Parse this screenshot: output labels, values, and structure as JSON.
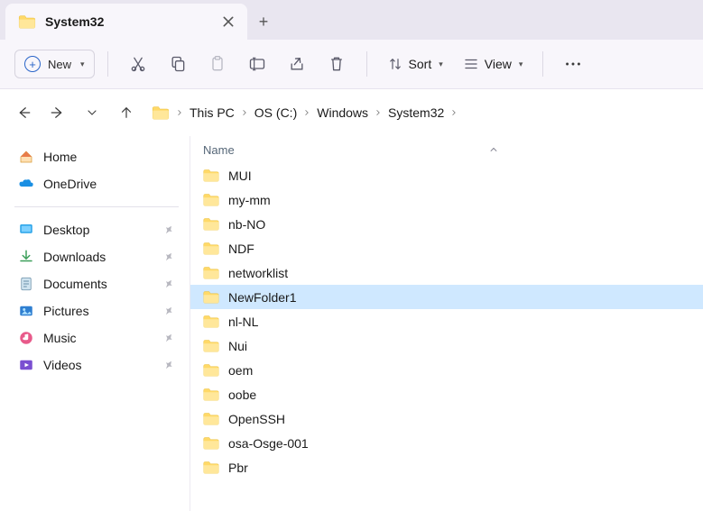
{
  "tab": {
    "title": "System32"
  },
  "toolbar": {
    "new_label": "New",
    "sort_label": "Sort",
    "view_label": "View"
  },
  "breadcrumbs": {
    "items": [
      {
        "label": "This PC"
      },
      {
        "label": "OS (C:)"
      },
      {
        "label": "Windows"
      },
      {
        "label": "System32"
      }
    ]
  },
  "sidebar": {
    "quick": [
      {
        "label": "Home",
        "icon": "home"
      },
      {
        "label": "OneDrive",
        "icon": "onedrive"
      }
    ],
    "places": [
      {
        "label": "Desktop",
        "icon": "desktop"
      },
      {
        "label": "Downloads",
        "icon": "downloads"
      },
      {
        "label": "Documents",
        "icon": "documents"
      },
      {
        "label": "Pictures",
        "icon": "pictures"
      },
      {
        "label": "Music",
        "icon": "music"
      },
      {
        "label": "Videos",
        "icon": "videos"
      }
    ]
  },
  "list": {
    "column_header": "Name",
    "items": [
      {
        "name": "MUI"
      },
      {
        "name": "my-mm"
      },
      {
        "name": "nb-NO"
      },
      {
        "name": "NDF"
      },
      {
        "name": "networklist"
      },
      {
        "name": "NewFolder1",
        "selected": true
      },
      {
        "name": "nl-NL"
      },
      {
        "name": "Nui"
      },
      {
        "name": "oem"
      },
      {
        "name": "oobe"
      },
      {
        "name": "OpenSSH"
      },
      {
        "name": "osa-Osge-001"
      },
      {
        "name": "Pbr"
      }
    ]
  }
}
